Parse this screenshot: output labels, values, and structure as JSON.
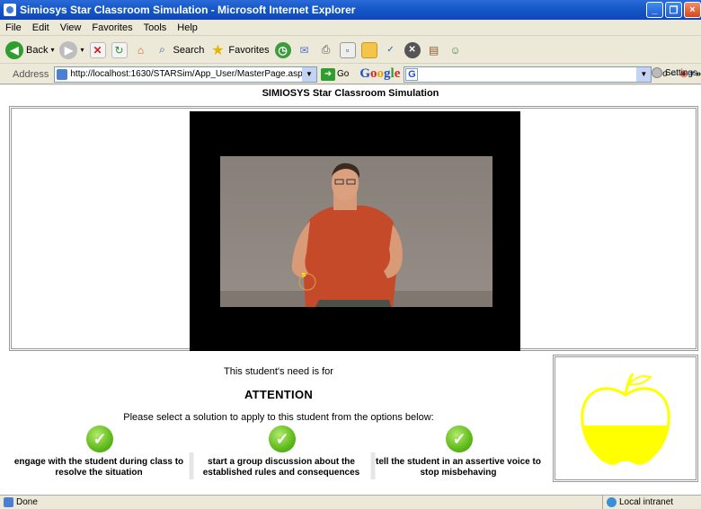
{
  "window": {
    "title": "Simiosys Star Classroom Simulation - Microsoft Internet Explorer",
    "controls": [
      "minimize",
      "maximize",
      "close"
    ]
  },
  "menu": [
    "File",
    "Edit",
    "View",
    "Favorites",
    "Tools",
    "Help"
  ],
  "toolbar": {
    "back_label": "Back",
    "search_label": "Search",
    "favorites_label": "Favorites"
  },
  "address": {
    "label": "Address",
    "url": "http://localhost:1630/STARSim/App_User/MasterPage.aspx",
    "go_label": "Go"
  },
  "google_bar": {
    "logo": [
      "G",
      "o",
      "o",
      "g",
      "l",
      "e"
    ],
    "g_button": "G",
    "go_label": "Go",
    "settings_label": "Settings"
  },
  "page": {
    "title": "SIMIOSYS Star Classroom Simulation",
    "need_text": "This student's need is for",
    "need_value": "ATTENTION",
    "instruction": "Please select a solution to apply to this student from the options below:",
    "options": [
      "engage with the student during class to resolve the situation",
      "start a group discussion about the established rules and consequences",
      "tell the student in an assertive voice to stop misbehaving"
    ],
    "apple_fill_color": "#ffff00",
    "apple_fill_level": 0.5
  },
  "status": {
    "left": "Done",
    "zone": "Local intranet"
  },
  "colors": {
    "titlebar": "#1657c9",
    "check_green": "#5fba1a"
  }
}
